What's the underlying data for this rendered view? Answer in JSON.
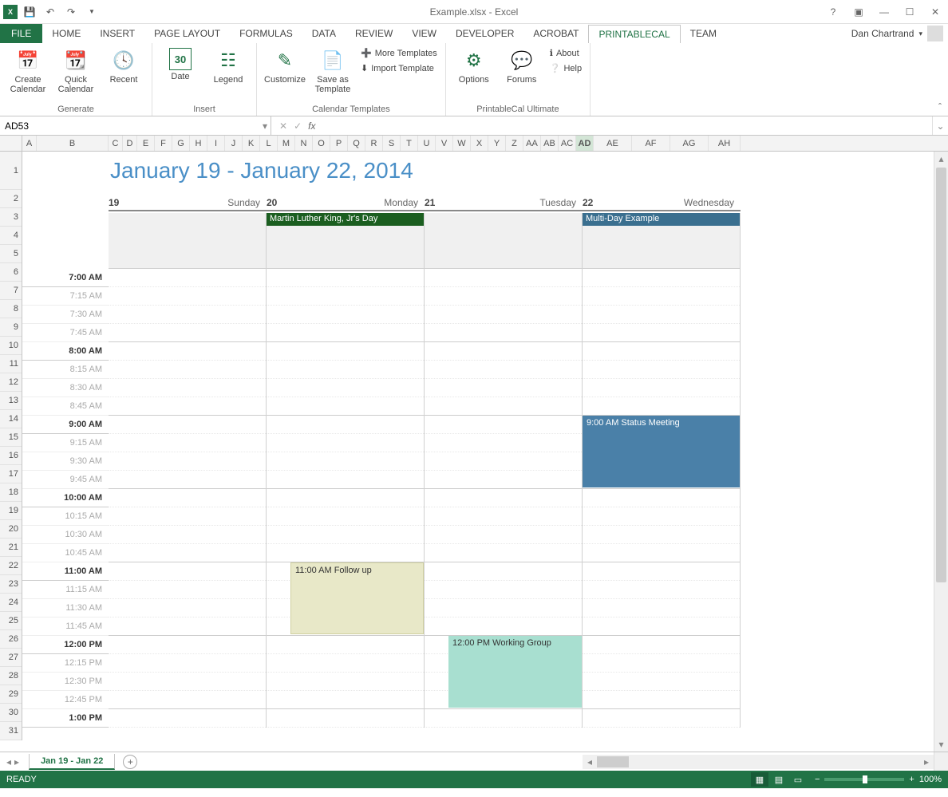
{
  "title": "Example.xlsx - Excel",
  "user": "Dan Chartrand",
  "ribbon_tabs": [
    "FILE",
    "HOME",
    "INSERT",
    "PAGE LAYOUT",
    "FORMULAS",
    "DATA",
    "REVIEW",
    "VIEW",
    "DEVELOPER",
    "ACROBAT",
    "PRINTABLECAL",
    "TEAM"
  ],
  "active_tab": "PRINTABLECAL",
  "ribbon": {
    "generate": {
      "label": "Generate",
      "create": "Create Calendar",
      "quick": "Quick Calendar",
      "recent": "Recent"
    },
    "insert": {
      "label": "Insert",
      "date": "Date",
      "legend": "Legend"
    },
    "templates": {
      "label": "Calendar Templates",
      "customize": "Customize",
      "saveas": "Save as Template",
      "more": "More Templates",
      "import": "Import Template"
    },
    "ultimate": {
      "label": "PrintableCal Ultimate",
      "options": "Options",
      "forums": "Forums",
      "about": "About",
      "help": "Help"
    }
  },
  "name_box": "AD53",
  "columns": [
    {
      "l": "A",
      "w": 18
    },
    {
      "l": "B",
      "w": 90
    },
    {
      "l": "C",
      "w": 18
    },
    {
      "l": "D",
      "w": 18
    },
    {
      "l": "E",
      "w": 22
    },
    {
      "l": "F",
      "w": 22
    },
    {
      "l": "G",
      "w": 22
    },
    {
      "l": "H",
      "w": 22
    },
    {
      "l": "I",
      "w": 22
    },
    {
      "l": "J",
      "w": 22
    },
    {
      "l": "K",
      "w": 22
    },
    {
      "l": "L",
      "w": 22
    },
    {
      "l": "M",
      "w": 22
    },
    {
      "l": "N",
      "w": 22
    },
    {
      "l": "O",
      "w": 22
    },
    {
      "l": "P",
      "w": 22
    },
    {
      "l": "Q",
      "w": 22
    },
    {
      "l": "R",
      "w": 22
    },
    {
      "l": "S",
      "w": 22
    },
    {
      "l": "T",
      "w": 22
    },
    {
      "l": "U",
      "w": 22
    },
    {
      "l": "V",
      "w": 22
    },
    {
      "l": "W",
      "w": 22
    },
    {
      "l": "X",
      "w": 22
    },
    {
      "l": "Y",
      "w": 22
    },
    {
      "l": "Z",
      "w": 22
    },
    {
      "l": "AA",
      "w": 22
    },
    {
      "l": "AB",
      "w": 22
    },
    {
      "l": "AC",
      "w": 22
    },
    {
      "l": "AD",
      "w": 22
    },
    {
      "l": "AE",
      "w": 48
    },
    {
      "l": "AF",
      "w": 48
    },
    {
      "l": "AG",
      "w": 48
    },
    {
      "l": "AH",
      "w": 40
    }
  ],
  "sel_col": "AD",
  "rows_first_tall": true,
  "row_count": 31,
  "calendar": {
    "title": "January 19 - January 22, 2014",
    "days": [
      {
        "num": "19",
        "name": "Sunday"
      },
      {
        "num": "20",
        "name": "Monday"
      },
      {
        "num": "21",
        "name": "Tuesday"
      },
      {
        "num": "22",
        "name": "Wednesday"
      }
    ],
    "allday": [
      {
        "day": 1,
        "text": "Martin Luther King, Jr's Day",
        "cls": "ev-green"
      },
      {
        "day": 3,
        "text": "Multi-Day Example",
        "cls": "ev-blue"
      }
    ],
    "times": [
      "7:00 AM",
      "7:15 AM",
      "7:30 AM",
      "7:45 AM",
      "8:00 AM",
      "8:15 AM",
      "8:30 AM",
      "8:45 AM",
      "9:00 AM",
      "9:15 AM",
      "9:30 AM",
      "9:45 AM",
      "10:00 AM",
      "10:15 AM",
      "10:30 AM",
      "10:45 AM",
      "11:00 AM",
      "11:15 AM",
      "11:30 AM",
      "11:45 AM",
      "12:00 PM",
      "12:15 PM",
      "12:30 PM",
      "12:45 PM",
      "1:00 PM"
    ],
    "events": [
      {
        "day": 3,
        "start": 8,
        "span": 4,
        "text": "9:00 AM  Status Meeting",
        "cls": "ev-status",
        "full": true
      },
      {
        "day": 1,
        "start": 16,
        "span": 4,
        "text": "11:00 AM  Follow up",
        "cls": "ev-follow",
        "full": false
      },
      {
        "day": 2,
        "start": 20,
        "span": 4,
        "text": "12:00 PM  Working Group",
        "cls": "ev-working",
        "full": false
      }
    ]
  },
  "sheet_tab": "Jan 19 - Jan 22",
  "status": "READY",
  "zoom": "100%"
}
